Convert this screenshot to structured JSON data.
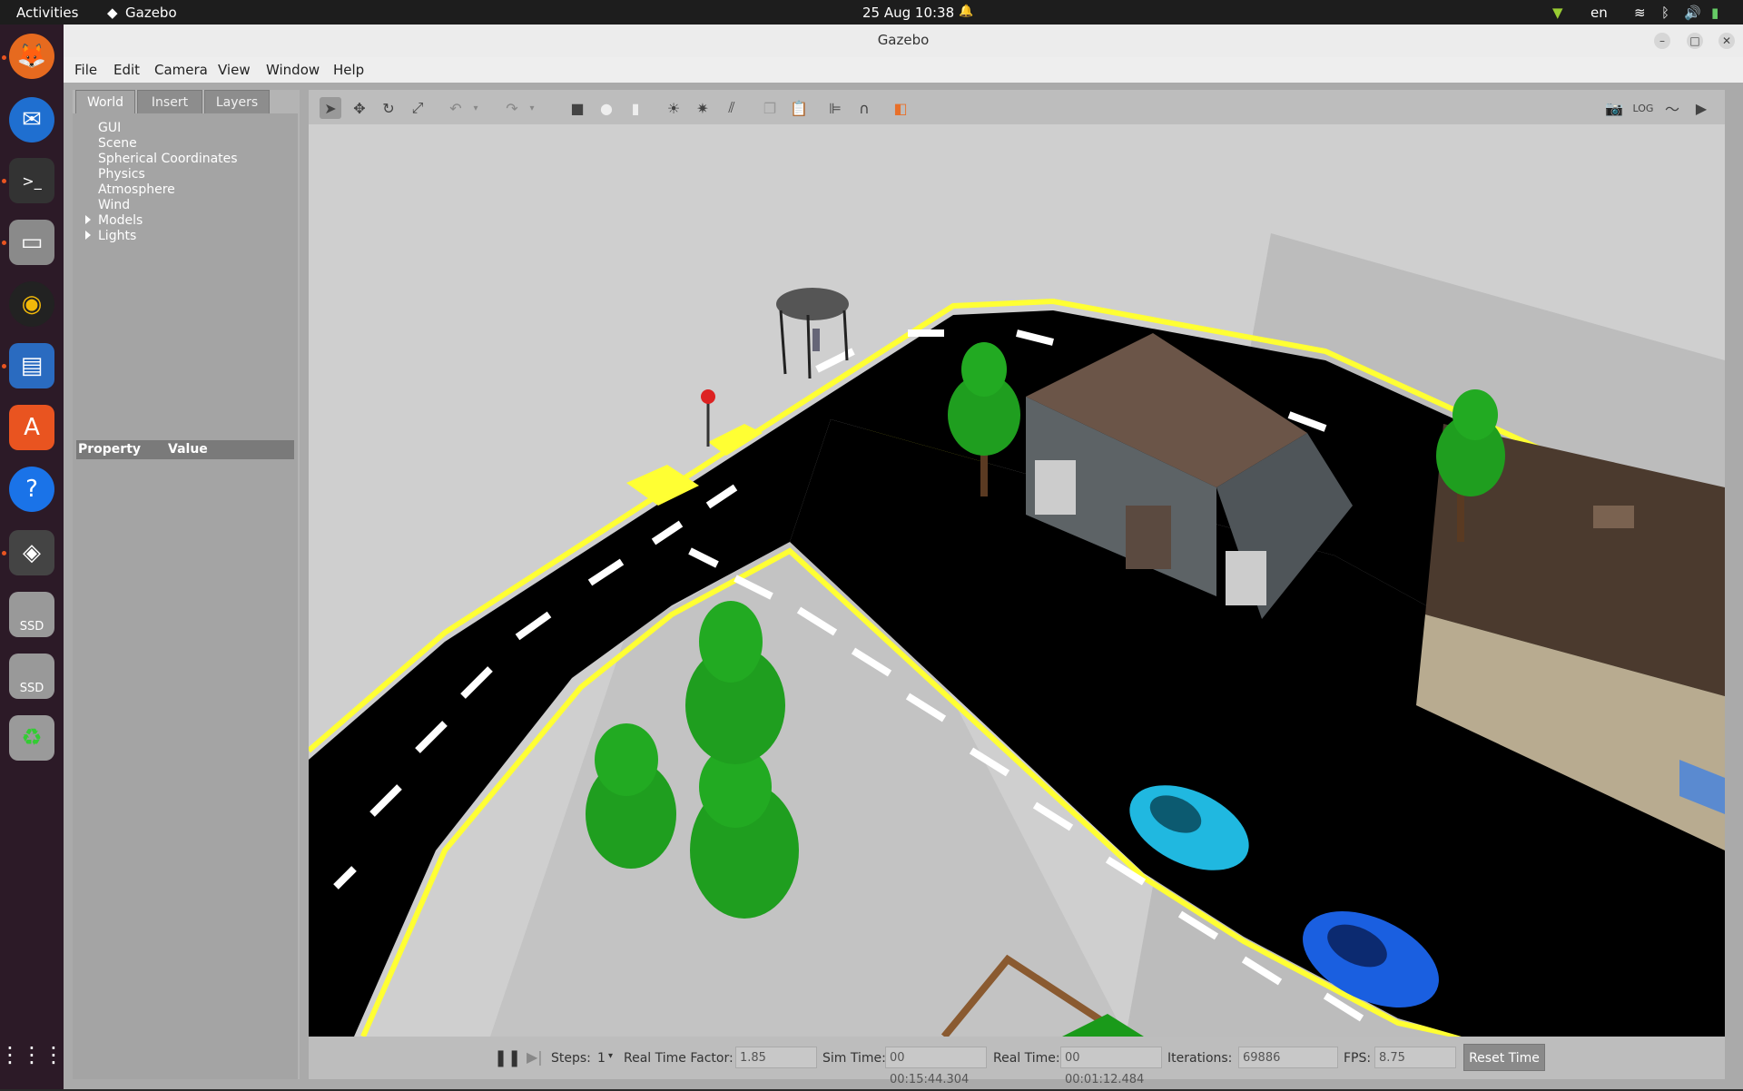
{
  "topbar": {
    "activities": "Activities",
    "app_name": "Gazebo",
    "clock": "25 Aug  10:38",
    "lang": "en"
  },
  "window": {
    "title": "Gazebo"
  },
  "menu": {
    "file": "File",
    "edit": "Edit",
    "camera": "Camera",
    "view": "View",
    "window": "Window",
    "help": "Help"
  },
  "left_panel": {
    "tabs": [
      "World",
      "Insert",
      "Layers"
    ],
    "tree": [
      "GUI",
      "Scene",
      "Spherical Coordinates",
      "Physics",
      "Atmosphere",
      "Wind",
      "Models",
      "Lights"
    ],
    "property_header": "Property",
    "value_header": "Value"
  },
  "dock": {
    "ssd1": "SSD",
    "ssd2": "SSD"
  },
  "status": {
    "steps_label": "Steps:",
    "steps_value": "1",
    "rtf_label": "Real Time Factor:",
    "rtf_value": "1.85",
    "sim_label": "Sim Time:",
    "sim_value": "00 00:15:44.304",
    "real_label": "Real Time:",
    "real_value": "00 00:01:12.484",
    "iter_label": "Iterations:",
    "iter_value": "69886",
    "fps_label": "FPS:",
    "fps_value": "8.75",
    "reset": "Reset Time"
  },
  "colors": {
    "road": "#000000",
    "road_edge": "#ffff33",
    "ground": "#cfcfcf",
    "tree": "#1f9e1f",
    "car_cyan": "#20b8e0",
    "car_blue": "#1a5fe0"
  }
}
